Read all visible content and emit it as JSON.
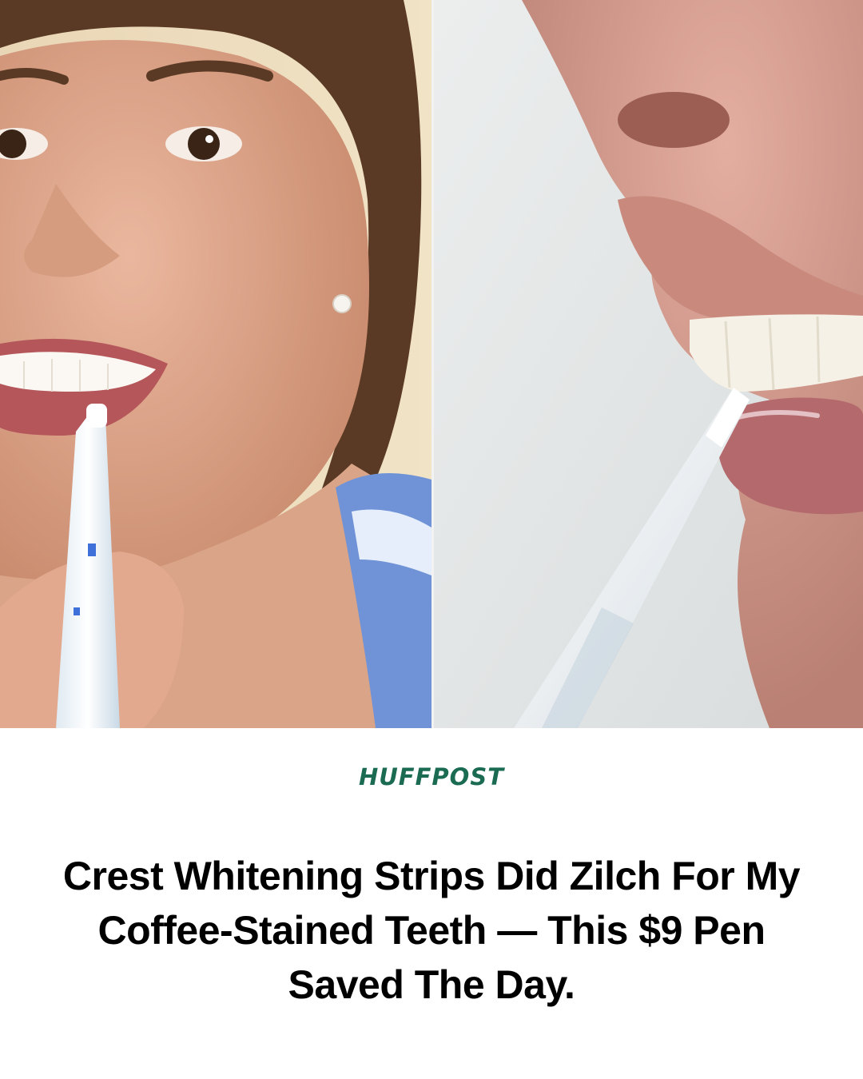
{
  "card": {
    "brand": "HUFFPOST",
    "headline": "Crest Whitening Strips Did Zilch For My Coffee-Stained Teeth — This $9 Pen Saved The Day.",
    "brand_color": "#1b6b53",
    "background": "#ffffff"
  },
  "photos": {
    "left": "woman-applying-whitening-pen-photo",
    "right": "closeup-teeth-with-whitening-pen-photo"
  }
}
